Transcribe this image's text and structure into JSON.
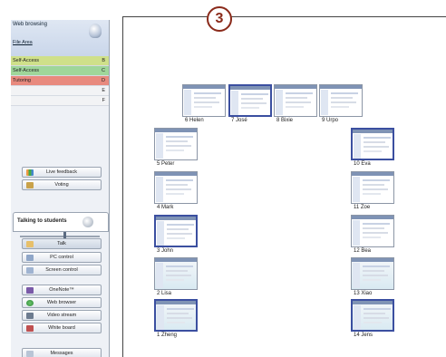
{
  "badge": "3",
  "panel": {
    "title": "Web browsing",
    "file_area": "File Area",
    "rows": [
      {
        "label": "Self-Access",
        "key": "B",
        "color": "#cfe08a"
      },
      {
        "label": "Self-Access",
        "key": "C",
        "color": "#9fd69a"
      },
      {
        "label": "Tutoring",
        "key": "D",
        "color": "#e88a7e"
      },
      {
        "label": "",
        "key": "E",
        "color": "#f2f3f5"
      },
      {
        "label": "",
        "key": "F",
        "color": "#f2f3f5"
      }
    ],
    "live_feedback": "Live feedback",
    "voting": "Voting",
    "talking_to_students": "Talking to students",
    "talk": "Talk",
    "pc_control": "PC control",
    "screen_control": "Screen control",
    "onenote": "OneNote™",
    "web_browser": "Web browser",
    "video_stream": "Video stream",
    "white_board": "White board",
    "messages": "Messages"
  },
  "students": [
    {
      "name": "6 Helen",
      "selected": false
    },
    {
      "name": "7 José",
      "selected": true
    },
    {
      "name": "8 Bixie",
      "selected": false
    },
    {
      "name": "9 Urpo",
      "selected": false
    },
    {
      "name": "5 Peter",
      "selected": false
    },
    {
      "name": "10 Eva",
      "selected": true
    },
    {
      "name": "4 Mark",
      "selected": false
    },
    {
      "name": "11 Zoe",
      "selected": false
    },
    {
      "name": "3 John",
      "selected": true
    },
    {
      "name": "12 Bea",
      "selected": false
    },
    {
      "name": "2 Lisa",
      "selected": false
    },
    {
      "name": "13 Xiao",
      "selected": false
    },
    {
      "name": "1 Zheng",
      "selected": true
    },
    {
      "name": "14 Jens",
      "selected": true
    }
  ],
  "colors": {
    "accent": "#3b4fa0",
    "badge": "#8a2a1a",
    "talk_active": "#cdd6e3"
  }
}
